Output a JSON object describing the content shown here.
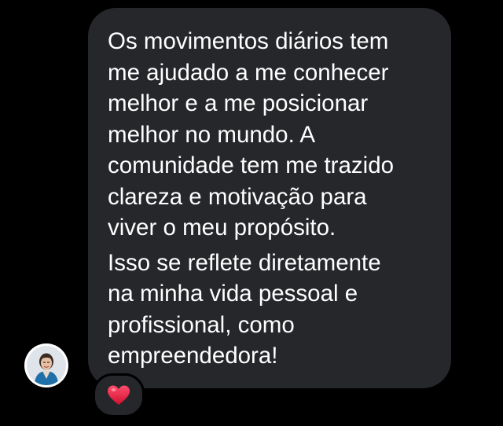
{
  "message": {
    "paragraphs": [
      "Os movimentos diários tem\nme ajudado a me conhecer\nmelhor e a me posicionar\nmelhor no mundo. A\ncomunidade tem me trazido\nclareza e motivação para\nviver o meu propósito.",
      "Isso se reflete diretamente\nna minha vida pessoal e\nprofissional, como\nempreendedora!"
    ]
  },
  "sender": {
    "avatar_icon": "profile-photo"
  },
  "reaction": {
    "emoji_icon": "red-heart-icon",
    "color": "#e0245e"
  },
  "colors": {
    "background": "#000000",
    "bubble": "#26272b",
    "text": "#ffffff"
  }
}
